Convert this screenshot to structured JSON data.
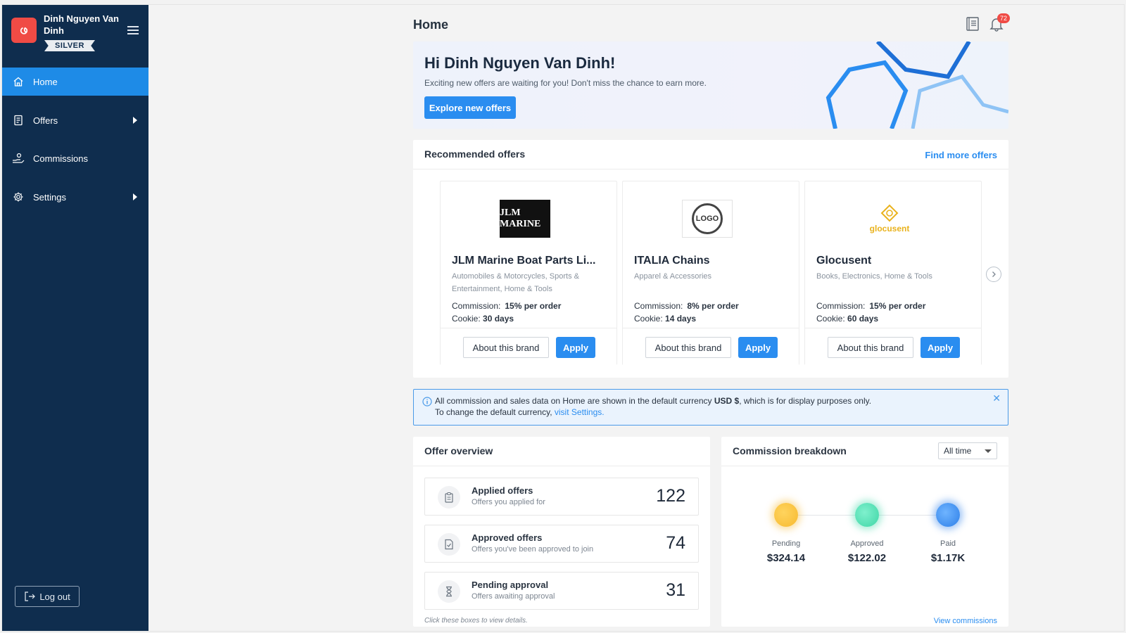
{
  "user": {
    "name": "Dinh Nguyen Van Dinh",
    "tier": "SILVER",
    "logo_letter": "ဖ"
  },
  "sidebar": {
    "items": [
      {
        "label": "Home",
        "icon": "home-icon",
        "active": true
      },
      {
        "label": "Offers",
        "icon": "document-icon",
        "active": false,
        "expandable": true
      },
      {
        "label": "Commissions",
        "icon": "hand-coin-icon",
        "active": false
      },
      {
        "label": "Settings",
        "icon": "gear-icon",
        "active": false,
        "expandable": true
      }
    ],
    "logout_label": "Log out"
  },
  "header": {
    "title": "Home",
    "notification_count": "72"
  },
  "hero": {
    "title": "Hi Dinh Nguyen Van Dinh!",
    "subtitle": "Exciting new offers are waiting for you! Don't miss the chance to earn more.",
    "button": "Explore new offers"
  },
  "recommended": {
    "title": "Recommended offers",
    "find_more": "Find more offers",
    "offers": [
      {
        "name": "JLM Marine Boat Parts Li...",
        "category": "Automobiles & Motorcycles, Sports & Entertainment, Home & Tools",
        "commission_label": "Commission:",
        "commission": "15% per order",
        "cookie_label": "Cookie:",
        "cookie": "30 days",
        "about": "About this brand",
        "apply": "Apply",
        "logo_text": "JLM MARINE"
      },
      {
        "name": "ITALIA Chains",
        "category": "Apparel & Accessories",
        "commission_label": "Commission:",
        "commission": "8% per order",
        "cookie_label": "Cookie:",
        "cookie": "14 days",
        "about": "About this brand",
        "apply": "Apply",
        "logo_text": "LOGO"
      },
      {
        "name": "Glocusent",
        "category": "Books, Electronics, Home & Tools",
        "commission_label": "Commission:",
        "commission": "15% per order",
        "cookie_label": "Cookie:",
        "cookie": "60 days",
        "about": "About this brand",
        "apply": "Apply",
        "logo_text": "glocusent"
      }
    ]
  },
  "notice": {
    "text_before": "All commission and sales data on Home are shown in the default currency ",
    "currency": "USD $",
    "text_after": ", which is for display purposes only.",
    "line2_before": "To change the default currency, ",
    "link": "visit Settings."
  },
  "overview": {
    "title": "Offer overview",
    "stats": [
      {
        "title": "Applied offers",
        "subtitle": "Offers you applied for",
        "value": "122",
        "icon": "clipboard-icon"
      },
      {
        "title": "Approved offers",
        "subtitle": "Offers you've been approved to join",
        "value": "74",
        "icon": "file-check-icon"
      },
      {
        "title": "Pending approval",
        "subtitle": "Offers awaiting approval",
        "value": "31",
        "icon": "hourglass-icon"
      }
    ],
    "hint": "Click these boxes to view details."
  },
  "breakdown": {
    "title": "Commission breakdown",
    "range": "All time",
    "items": [
      {
        "label": "Pending",
        "value": "$324.14",
        "color": "#f7b92f"
      },
      {
        "label": "Approved",
        "value": "$122.02",
        "color": "#3fd6a6"
      },
      {
        "label": "Paid",
        "value": "$1.17K",
        "color": "#2d7fe8"
      }
    ],
    "view_link": "View commissions"
  },
  "colors": {
    "sidebar": "#0f2d4e",
    "accent": "#2a8df0",
    "active_nav": "#1e8be7",
    "brand_red": "#f04b45"
  }
}
